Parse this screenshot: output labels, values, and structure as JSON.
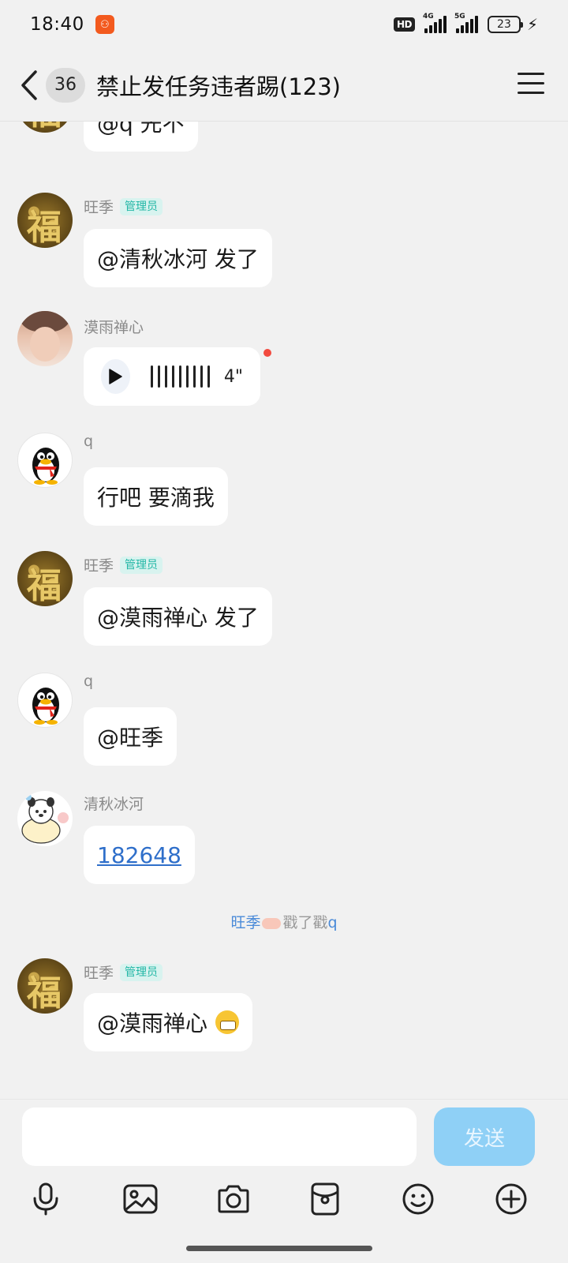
{
  "status_bar": {
    "time": "18:40",
    "app_badge": "⚇",
    "hd": "HD",
    "net1": "4G",
    "net2": "5G",
    "battery": "23"
  },
  "header": {
    "unread_count": "36",
    "title": "禁止发任务违者踢(123)"
  },
  "messages": [
    {
      "sender": "",
      "text": "@q 先不"
    },
    {
      "sender": "旺季",
      "role": "管理员",
      "text": "@清秋冰河 发了"
    },
    {
      "sender": "漠雨禅心",
      "voice_duration": "4\""
    },
    {
      "sender": "q",
      "text": "行吧 要滴我"
    },
    {
      "sender": "旺季",
      "role": "管理员",
      "text": "@漠雨禅心 发了"
    },
    {
      "sender": "q",
      "text": "@旺季"
    },
    {
      "sender": "清秋冰河",
      "text": "182648"
    },
    {
      "sender": "旺季",
      "role": "管理员",
      "text": "@漠雨禅心"
    }
  ],
  "system": {
    "actor": "旺季",
    "action": "戳了戳",
    "target": "q"
  },
  "input": {
    "placeholder": "",
    "send_label": "发送"
  },
  "toolbar": {
    "icons": [
      "microphone-icon",
      "image-icon",
      "camera-icon",
      "red-packet-icon",
      "emoji-icon",
      "plus-icon"
    ]
  },
  "colors": {
    "accent": "#8fd0f6",
    "admin_badge_text": "#23b7a6",
    "link": "#2f6fca",
    "unread_dot": "#f24a3f"
  }
}
